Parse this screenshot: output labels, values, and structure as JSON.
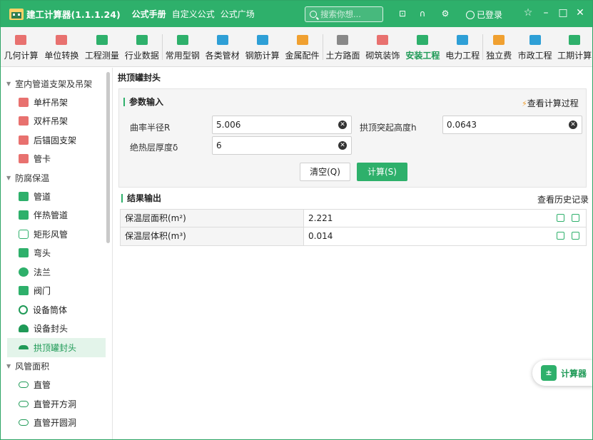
{
  "titlebar": {
    "app_name": "建工计算器(1.1.1.24)",
    "tabs": [
      "公式手册",
      "自定义公式",
      "公式广场"
    ],
    "search_placeholder": "搜索你想...",
    "login_label": "已登录"
  },
  "toolbar": {
    "items": [
      {
        "label": "几何计算",
        "color": "#e8716f"
      },
      {
        "label": "单位转换",
        "color": "#e8716f"
      },
      {
        "label": "工程测量",
        "color": "#2eb06b"
      },
      {
        "label": "行业数据",
        "color": "#2eb06b"
      },
      {
        "label": "常用型钢",
        "color": "#2eb06b"
      },
      {
        "label": "各类管材",
        "color": "#2e9fd6"
      },
      {
        "label": "钢筋计算",
        "color": "#2e9fd6"
      },
      {
        "label": "金属配件",
        "color": "#f0a030"
      },
      {
        "label": "土方路面",
        "color": "#888888"
      },
      {
        "label": "砌筑装饰",
        "color": "#e8716f"
      },
      {
        "label": "安装工程",
        "color": "#2eb06b"
      },
      {
        "label": "电力工程",
        "color": "#2e9fd6"
      },
      {
        "label": "独立费",
        "color": "#f0a030"
      },
      {
        "label": "市政工程",
        "color": "#2e9fd6"
      },
      {
        "label": "工期计算",
        "color": "#2eb06b"
      }
    ],
    "active_index": 10
  },
  "sidebar": {
    "groups": [
      {
        "label": "室内管道支架及吊架",
        "items": [
          "单杆吊架",
          "双杆吊架",
          "后锚固支架",
          "管卡"
        ]
      },
      {
        "label": "防腐保温",
        "items": [
          "管道",
          "伴热管道",
          "矩形风管",
          "弯头",
          "法兰",
          "阀门",
          "设备筒体",
          "设备封头",
          "拱顶罐封头"
        ]
      },
      {
        "label": "风管面积",
        "items": [
          "直管",
          "直管开方洞",
          "直管开圆洞"
        ]
      }
    ],
    "active_item": "拱顶罐封头"
  },
  "main": {
    "page_title": "拱顶罐封头",
    "input_section_title": "参数输入",
    "view_process_link": "查看计算过程",
    "fields": [
      {
        "label": "曲率半径R",
        "value": "5.006"
      },
      {
        "label": "拱顶突起高度h",
        "value": "0.0643"
      },
      {
        "label": "绝热层厚度δ",
        "value": "6"
      }
    ],
    "clear_button": "清空(Q)",
    "calc_button": "计算(S)",
    "output_section_title": "结果输出",
    "history_link": "查看历史记录",
    "results": [
      {
        "label": "保温层面积(m²)",
        "value": "2.221"
      },
      {
        "label": "保温层体积(m³)",
        "value": "0.014"
      }
    ]
  },
  "fab": {
    "label": "计算器"
  },
  "colors": {
    "brand": "#2eb06b",
    "active_bg": "#e3f4ea"
  }
}
